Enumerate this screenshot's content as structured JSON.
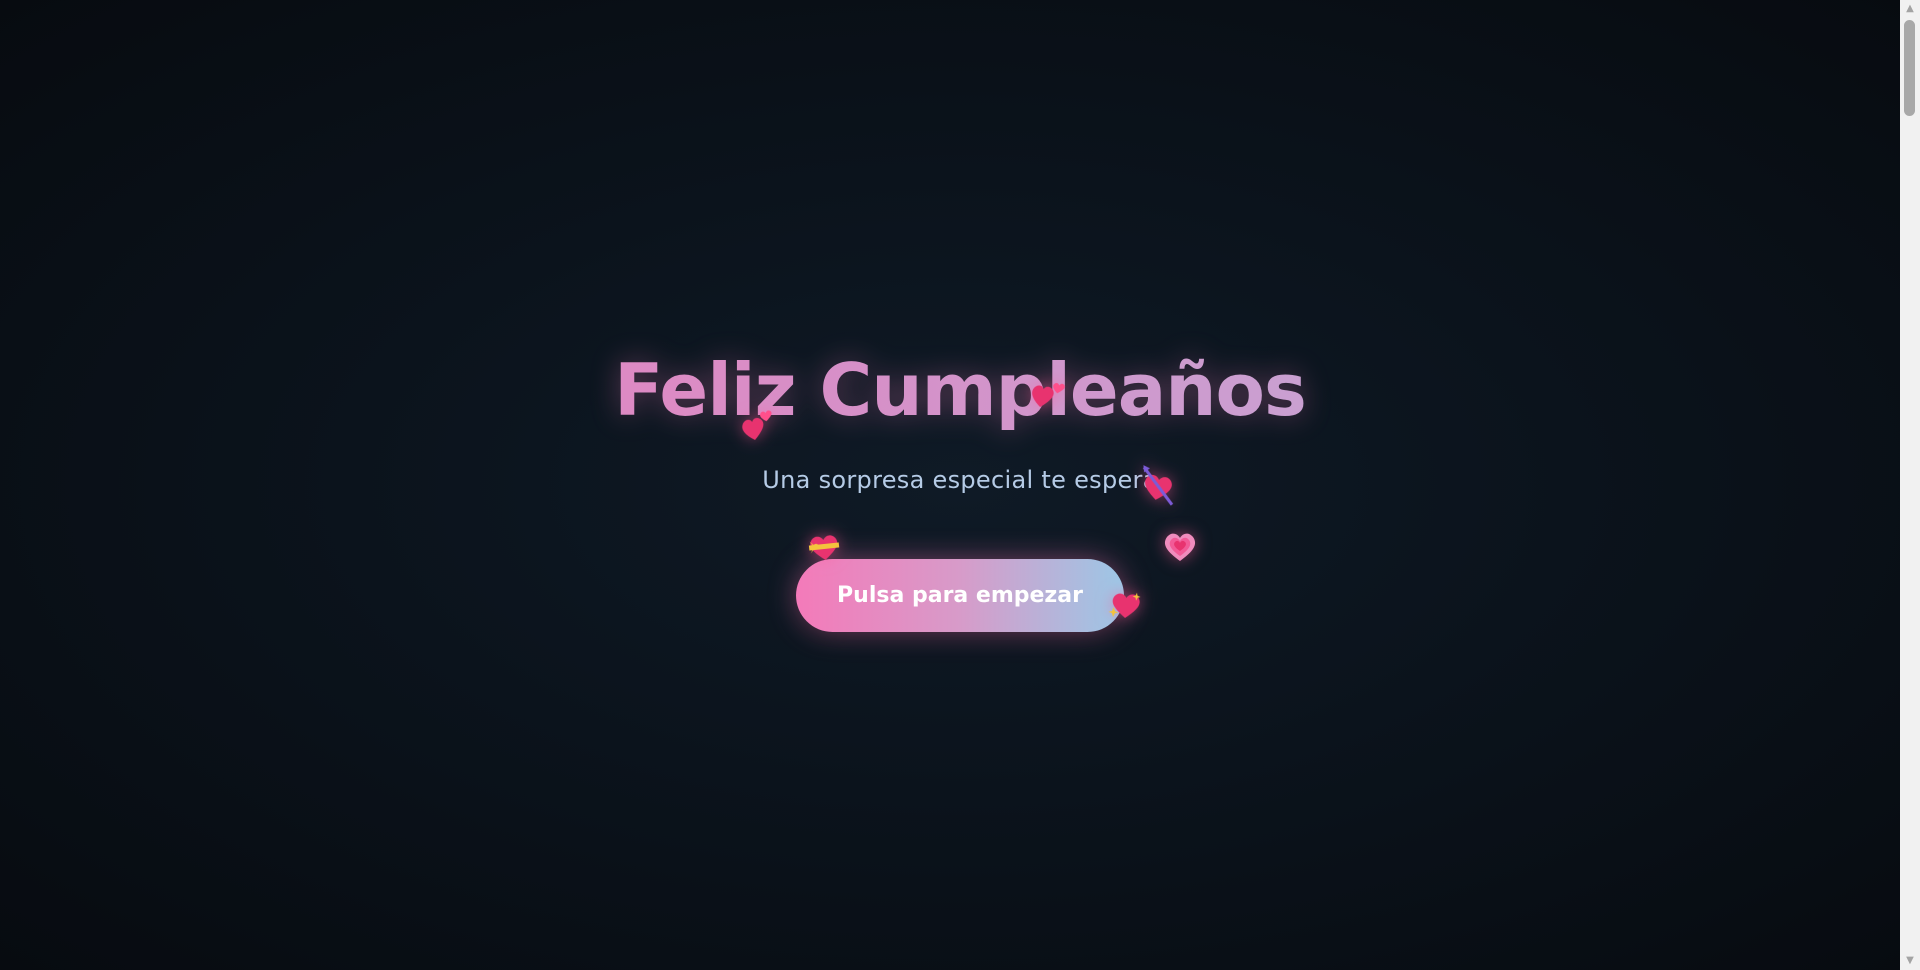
{
  "hero": {
    "title": "Feliz Cumpleaños",
    "subtitle": "Una sorpresa especial te espera",
    "start_button_label": "Pulsa para empezar"
  },
  "decorations": {
    "hearts": [
      {
        "icon": "double-heart-icon"
      },
      {
        "icon": "double-heart-icon"
      },
      {
        "icon": "heart-with-arrow-icon"
      },
      {
        "icon": "heart-with-ribbon-icon"
      },
      {
        "icon": "growing-heart-icon"
      },
      {
        "icon": "sparkling-heart-icon"
      }
    ]
  },
  "colors": {
    "background": "#0b131c",
    "title_gradient_start": "#f07ab8",
    "title_gradient_end": "#b8b6de",
    "subtitle": "#b5cbe6",
    "button_gradient_start": "#f47ab9",
    "button_gradient_end": "#9cc7e6",
    "heart": "#e8336f"
  },
  "scrollbar": {
    "up_glyph": "▲",
    "down_glyph": "▼"
  }
}
